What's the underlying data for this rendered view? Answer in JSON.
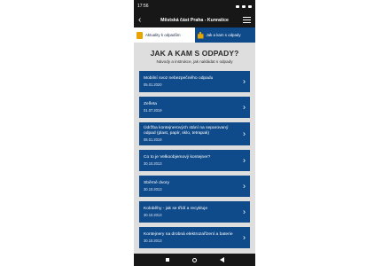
{
  "statusbar": {
    "time": "17:56"
  },
  "appbar": {
    "title": "Městská část Praha - Kunratice"
  },
  "tabs": [
    {
      "label": "Aktuality k odpadům",
      "active": false
    },
    {
      "label": "Jak a kam s odpady",
      "active": true
    }
  ],
  "main": {
    "heading": "JAK A KAM S ODPADY?",
    "subheading": "Návody a instrukce, jak nakládat s odpady",
    "items": [
      {
        "title": "Mobilní svoz nebezpečného odpadu",
        "date": "05.01.2020"
      },
      {
        "title": "Zeľleta",
        "date": "01.07.2019"
      },
      {
        "title": "Údržba kontejnerových stání na separovaný odpad (plast, papír, sklo, tetrapak)",
        "date": "08.01.2019"
      },
      {
        "title": "Co to je Velkoobjemový kontejner?",
        "date": "30.10.2013"
      },
      {
        "title": "Sběrné dvory",
        "date": "30.10.2013"
      },
      {
        "title": "Koloběhy - jak se třídí a recykluje",
        "date": "30.10.2013"
      },
      {
        "title": "Kontejnery na drobná elektrozařízení a baterie",
        "date": "30.10.2013"
      }
    ]
  },
  "colors": {
    "accent": "#0f4a8a",
    "bar": "#171717",
    "background": "#dedede",
    "tab_icon": "#e8a400"
  }
}
